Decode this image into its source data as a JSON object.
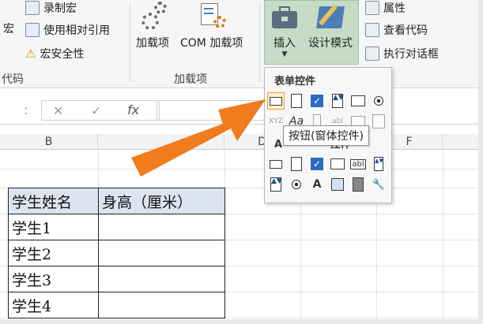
{
  "ribbon": {
    "code_group": {
      "record_macro": "录制宏",
      "relative_ref": "使用相对引用",
      "macro_security": "宏安全性",
      "left_partial": "宏",
      "group_label_partial": "代码"
    },
    "addins_group": {
      "addins": "加载项",
      "com_addins": "COM 加载项",
      "group_label": "加载项"
    },
    "controls_group": {
      "insert": "插入",
      "design_mode": "设计模式",
      "properties": "属性",
      "view_code": "查看代码",
      "run_dialog": "执行对话框"
    }
  },
  "formula_bar": {
    "cancel_icon": "✕",
    "enter_icon": "✓",
    "fx": "fx",
    "sep": ":"
  },
  "columns": [
    "B",
    "D",
    "F"
  ],
  "column_partial_e": "E",
  "dropdown": {
    "form_controls_title": "表单控件",
    "activex_title_partial": "A",
    "activex_title_tail": "控件",
    "form_controls": [
      "button-control",
      "combo-box",
      "check-box",
      "spin-button",
      "list-box",
      "option-button"
    ],
    "form_controls_row2": [
      "group-box",
      "label-control",
      "scroll-bar",
      "text-field",
      "combo-list-edit",
      "combo-drop-edit"
    ],
    "activex_controls": [
      "command-button",
      "combo-box",
      "check-box",
      "list-box",
      "text-box",
      "scroll-bar"
    ],
    "activex_controls_row2": [
      "spin-button",
      "option-button",
      "label-control",
      "image-control",
      "toggle-button",
      "more-controls"
    ],
    "tooltip": "按钮(窗体控件)"
  },
  "table": {
    "headers": [
      "学生姓名",
      "身高（厘米）"
    ],
    "rows": [
      "学生1",
      "学生2",
      "学生3",
      "学生4"
    ]
  },
  "colors": {
    "arrow": "#f07c1e",
    "insert_highlight": "#c6dcc6",
    "table_header_bg": "#dce3f1"
  }
}
